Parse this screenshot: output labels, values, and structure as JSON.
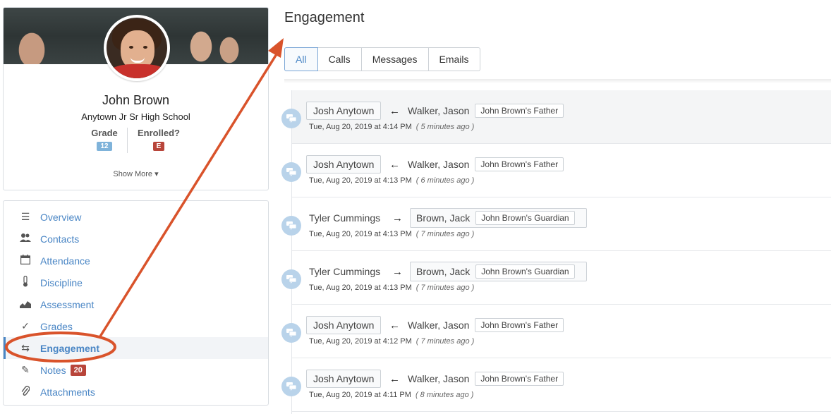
{
  "profile": {
    "name": "John Brown",
    "school": "Anytown Jr Sr High School",
    "grade_label": "Grade",
    "grade_value": "12",
    "enrolled_label": "Enrolled?",
    "enrolled_value": "E",
    "show_more": "Show More ▾"
  },
  "colors": {
    "accent": "#4a86c5",
    "grade_badge": "#7fb3da",
    "enrolled_badge": "#b8453a",
    "annotation": "#d9532b"
  },
  "nav": {
    "items": [
      {
        "label": "Overview",
        "icon": "list-icon",
        "glyph": "☰"
      },
      {
        "label": "Contacts",
        "icon": "users-icon",
        "glyph": "👥"
      },
      {
        "label": "Attendance",
        "icon": "calendar-icon",
        "glyph": "▭"
      },
      {
        "label": "Discipline",
        "icon": "thermometer-icon",
        "glyph": "🌡"
      },
      {
        "label": "Assessment",
        "icon": "area-chart-icon",
        "glyph": "◢"
      },
      {
        "label": "Grades",
        "icon": "check-icon",
        "glyph": "✓"
      },
      {
        "label": "Engagement",
        "icon": "exchange-icon",
        "glyph": "⇆",
        "active": true
      },
      {
        "label": "Notes",
        "icon": "pencil-icon",
        "glyph": "✎",
        "badge": "20"
      },
      {
        "label": "Attachments",
        "icon": "paperclip-icon",
        "glyph": "⎘"
      }
    ]
  },
  "main": {
    "title": "Engagement",
    "tabs": [
      "All",
      "Calls",
      "Messages",
      "Emails"
    ],
    "active_tab": "All",
    "entries": [
      {
        "from": "Josh Anytown",
        "direction": "←",
        "contact": "Walker, Jason",
        "relation": "John Brown's Father",
        "date": "Tue, Aug 20, 2019 at 4:14 PM",
        "ago": "( 5 minutes ago )",
        "staff_first": true
      },
      {
        "from": "Josh Anytown",
        "direction": "←",
        "contact": "Walker, Jason",
        "relation": "John Brown's Father",
        "date": "Tue, Aug 20, 2019 at 4:13 PM",
        "ago": "( 6 minutes ago )",
        "staff_first": true
      },
      {
        "from": "Tyler Cummings",
        "direction": "→",
        "contact": "Brown, Jack",
        "relation": "John Brown's Guardian",
        "date": "Tue, Aug 20, 2019 at 4:13 PM",
        "ago": "( 7 minutes ago )",
        "staff_first": false
      },
      {
        "from": "Tyler Cummings",
        "direction": "→",
        "contact": "Brown, Jack",
        "relation": "John Brown's Guardian",
        "date": "Tue, Aug 20, 2019 at 4:13 PM",
        "ago": "( 7 minutes ago )",
        "staff_first": false
      },
      {
        "from": "Josh Anytown",
        "direction": "←",
        "contact": "Walker, Jason",
        "relation": "John Brown's Father",
        "date": "Tue, Aug 20, 2019 at 4:12 PM",
        "ago": "( 7 minutes ago )",
        "staff_first": true
      },
      {
        "from": "Josh Anytown",
        "direction": "←",
        "contact": "Walker, Jason",
        "relation": "John Brown's Father",
        "date": "Tue, Aug 20, 2019 at 4:11 PM",
        "ago": "( 8 minutes ago )",
        "staff_first": true
      }
    ]
  }
}
